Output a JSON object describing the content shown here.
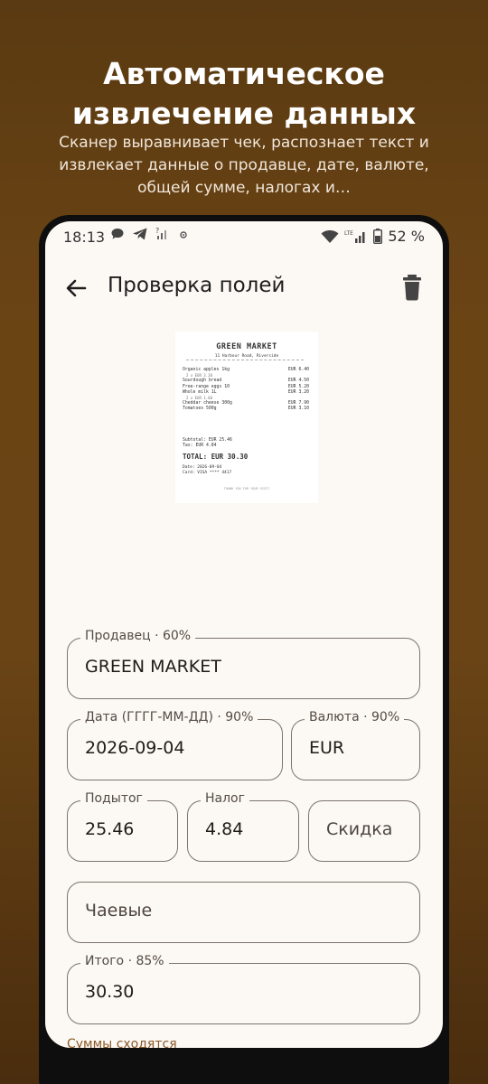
{
  "promo": {
    "title_line1": "Автоматическое",
    "title_line2": "извлечение данных",
    "subtitle": "Сканер выравнивает чек, распознает текст и извлекает данные о продавце, дате, валюте, общей сумме, налогах и…"
  },
  "statusbar": {
    "time": "18:13",
    "battery": "52 %",
    "icons_left": [
      "chat-icon",
      "telegram-icon",
      "no-signal-icon",
      "app-icon"
    ],
    "icons_right": [
      "wifi-icon",
      "lte-signal-icon",
      "battery-icon"
    ]
  },
  "appbar": {
    "title": "Проверка полей",
    "back_icon": "arrow-back-icon",
    "delete_icon": "trash-icon"
  },
  "receipt": {
    "store": "GREEN MARKET",
    "address": "11 Harbour Road, Riverside",
    "items": [
      {
        "name": "Organic apples 1kg",
        "price": "EUR 6.40",
        "detail": "2 x EUR 3.20"
      },
      {
        "name": "Sourdough bread",
        "price": "EUR 4.50",
        "detail": ""
      },
      {
        "name": "Free-range eggs 10",
        "price": "EUR 5.20",
        "detail": ""
      },
      {
        "name": "Whole milk 1L",
        "price": "EUR 3.20",
        "detail": "2 x EUR 1.60"
      },
      {
        "name": "Cheddar cheese 300g",
        "price": "EUR 7.90",
        "detail": ""
      },
      {
        "name": "Tomatoes 500g",
        "price": "EUR 3.10",
        "detail": ""
      }
    ],
    "subtotal": "Subtotal: EUR 25.46",
    "tax": "Tax: EUR 4.84",
    "total": "TOTAL: EUR 30.30",
    "date": "Date: 2026-09-04",
    "card": "Card: VISA **** 4417",
    "footer": "THANK YOU FOR YOUR VISIT"
  },
  "form": {
    "seller": {
      "label": "Продавец · 60%",
      "value": "GREEN MARKET"
    },
    "date": {
      "label": "Дата (ГГГГ-ММ-ДД) · 90%",
      "value": "2026-09-04"
    },
    "currency": {
      "label": "Валюта · 90%",
      "value": "EUR"
    },
    "subtotal": {
      "label": "Подытог",
      "value": "25.46"
    },
    "tax": {
      "label": "Налог",
      "value": "4.84"
    },
    "discount": {
      "placeholder": "Скидка"
    },
    "tips": {
      "placeholder": "Чаевые"
    },
    "total": {
      "label": "Итого · 85%",
      "value": "30.30"
    },
    "status": "Суммы сходятся"
  },
  "colors": {
    "background_top": "#5a3a12",
    "screen_bg": "#fcf8f4",
    "field_border": "#7d746c",
    "status_text": "#8a5a28"
  }
}
